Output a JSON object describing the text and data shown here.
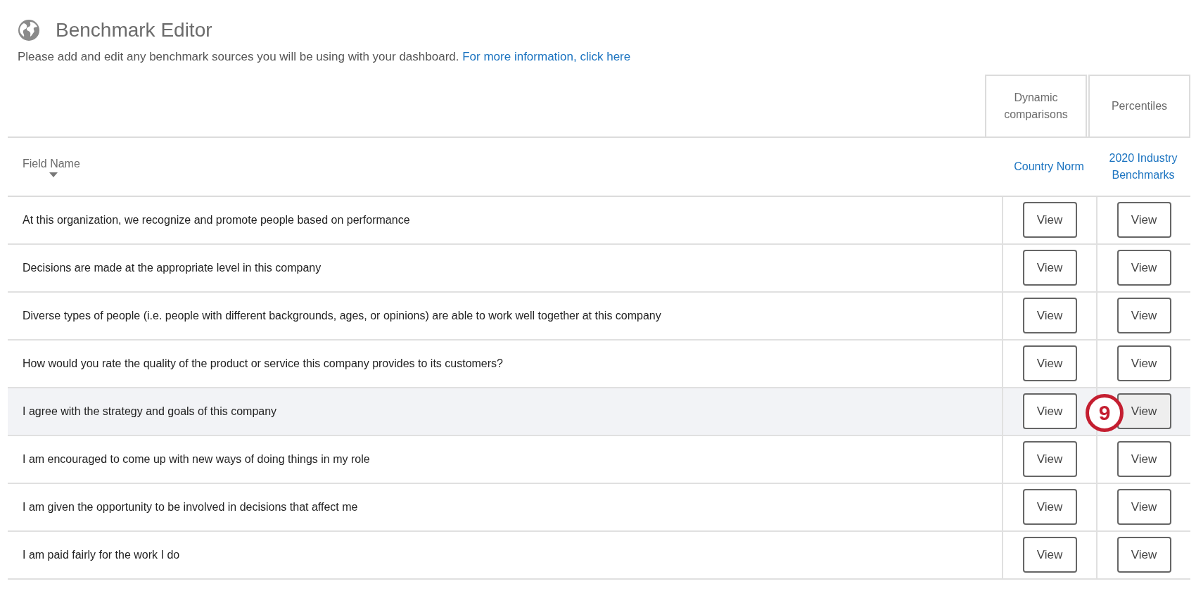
{
  "header": {
    "title": "Benchmark Editor",
    "description": "Please add and edit any benchmark sources you will be using with your dashboard.",
    "link": "For more information, click here"
  },
  "column_groups": [
    "Dynamic comparisons",
    "Percentiles"
  ],
  "columns": {
    "field": "Field Name",
    "sources": [
      "Country Norm",
      "2020 Industry Benchmarks"
    ]
  },
  "rows": [
    {
      "label": "At this organization, we recognize and promote people based on performance",
      "highlighted": false,
      "buttons": [
        {
          "label": "View",
          "hovered": false
        },
        {
          "label": "View",
          "hovered": false
        }
      ]
    },
    {
      "label": "Decisions are made at the appropriate level in this company",
      "highlighted": false,
      "buttons": [
        {
          "label": "View",
          "hovered": false
        },
        {
          "label": "View",
          "hovered": false
        }
      ]
    },
    {
      "label": "Diverse types of people (i.e. people with different backgrounds, ages, or opinions) are able to work well together at this company",
      "highlighted": false,
      "buttons": [
        {
          "label": "View",
          "hovered": false
        },
        {
          "label": "View",
          "hovered": false
        }
      ]
    },
    {
      "label": "How would you rate the quality of the product or service this company provides to its customers?",
      "highlighted": false,
      "buttons": [
        {
          "label": "View",
          "hovered": false
        },
        {
          "label": "View",
          "hovered": false
        }
      ]
    },
    {
      "label": "I agree with the strategy and goals of this company",
      "highlighted": true,
      "buttons": [
        {
          "label": "View",
          "hovered": false
        },
        {
          "label": "View",
          "hovered": true,
          "callout": "9"
        }
      ]
    },
    {
      "label": "I am encouraged to come up with new ways of doing things in my role",
      "highlighted": false,
      "buttons": [
        {
          "label": "View",
          "hovered": false
        },
        {
          "label": "View",
          "hovered": false
        }
      ]
    },
    {
      "label": "I am given the opportunity to be involved in decisions that affect me",
      "highlighted": false,
      "buttons": [
        {
          "label": "View",
          "hovered": false
        },
        {
          "label": "View",
          "hovered": false
        }
      ]
    },
    {
      "label": "I am paid fairly for the work I do",
      "highlighted": false,
      "buttons": [
        {
          "label": "View",
          "hovered": false
        },
        {
          "label": "View",
          "hovered": false
        }
      ]
    }
  ]
}
